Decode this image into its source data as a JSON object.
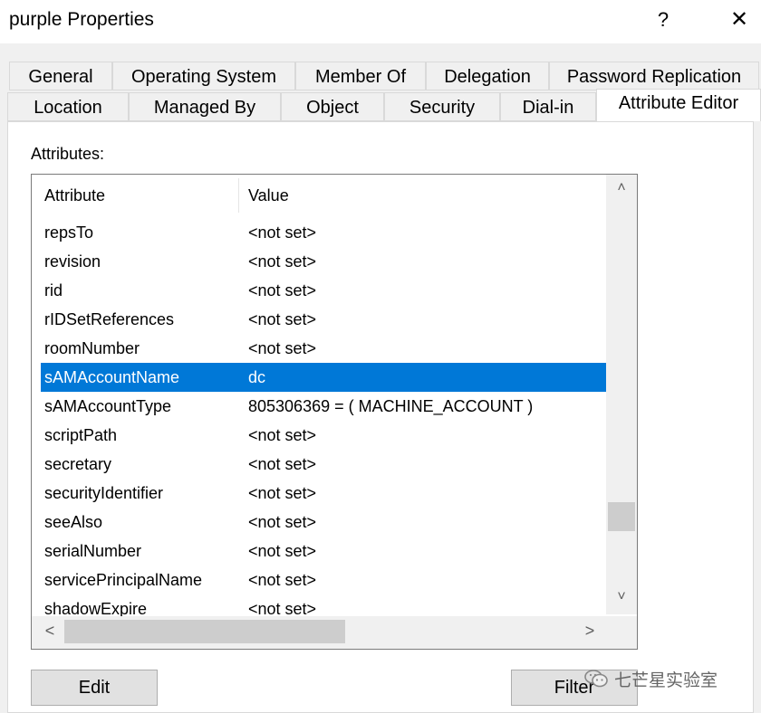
{
  "window": {
    "title": "purple Properties",
    "help_label": "?",
    "close_label": "✕"
  },
  "tabs": {
    "row1": [
      "General",
      "Operating System",
      "Member Of",
      "Delegation",
      "Password Replication"
    ],
    "row2": [
      "Location",
      "Managed By",
      "Object",
      "Security",
      "Dial-in",
      "Attribute Editor"
    ],
    "active": "Attribute Editor"
  },
  "attributes": {
    "label": "Attributes:",
    "columns": [
      "Attribute",
      "Value"
    ],
    "rows": [
      {
        "attribute": "repsTo",
        "value": "<not set>"
      },
      {
        "attribute": "revision",
        "value": "<not set>"
      },
      {
        "attribute": "rid",
        "value": "<not set>"
      },
      {
        "attribute": "rIDSetReferences",
        "value": "<not set>"
      },
      {
        "attribute": "roomNumber",
        "value": "<not set>"
      },
      {
        "attribute": "sAMAccountName",
        "value": "dc"
      },
      {
        "attribute": "sAMAccountType",
        "value": "805306369 = ( MACHINE_ACCOUNT )"
      },
      {
        "attribute": "scriptPath",
        "value": "<not set>"
      },
      {
        "attribute": "secretary",
        "value": "<not set>"
      },
      {
        "attribute": "securityIdentifier",
        "value": "<not set>"
      },
      {
        "attribute": "seeAlso",
        "value": "<not set>"
      },
      {
        "attribute": "serialNumber",
        "value": "<not set>"
      },
      {
        "attribute": "servicePrincipalName",
        "value": "<not set>"
      },
      {
        "attribute": "shadowExpire",
        "value": "<not set>"
      }
    ],
    "selected_attribute": "sAMAccountName"
  },
  "scrollbar_glyphs": {
    "up": "˄",
    "down": "˅",
    "left": "<",
    "right": ">"
  },
  "buttons": {
    "edit": "Edit",
    "filter": "Filter"
  },
  "watermark": {
    "text": "七芒星实验室"
  },
  "colors": {
    "selection": "#0078d7",
    "background": "#f0f0f0"
  }
}
